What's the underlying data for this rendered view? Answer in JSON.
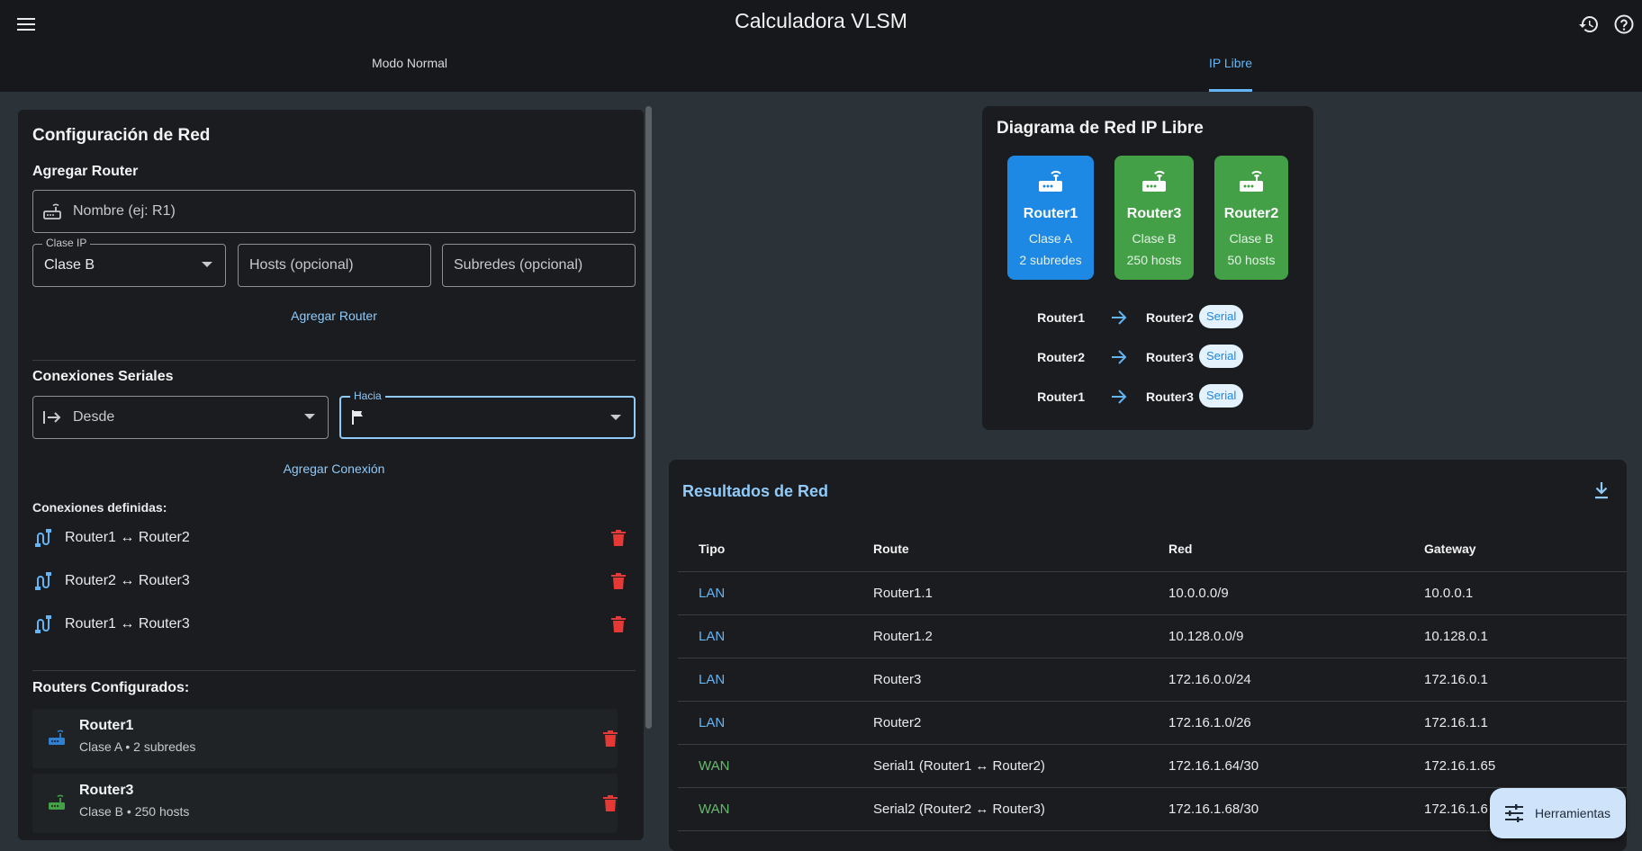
{
  "app": {
    "title": "Calculadora VLSM"
  },
  "tabs": [
    {
      "label": "Modo Normal"
    },
    {
      "label": "IP Libre"
    }
  ],
  "config": {
    "title": "Configuración de Red",
    "add_router": {
      "section_title": "Agregar Router",
      "name_placeholder": "Nombre (ej: R1)",
      "class_label": "Clase IP",
      "class_value": "Clase B",
      "hosts_placeholder": "Hosts (opcional)",
      "subnets_placeholder": "Subredes (opcional)",
      "button": "Agregar Router"
    },
    "serial": {
      "section_title": "Conexiones Seriales",
      "from_placeholder": "Desde",
      "to_label": "Hacia",
      "button": "Agregar Conexión"
    },
    "defined_title": "Conexiones definidas:",
    "connections": [
      {
        "text": "Router1 ↔ Router2"
      },
      {
        "text": "Router2 ↔ Router3"
      },
      {
        "text": "Router1 ↔ Router3"
      }
    ],
    "routers_title": "Routers Configurados:",
    "routers": [
      {
        "name": "Router1",
        "detail": "Clase A • 2 subredes",
        "color": "#2f80d0"
      },
      {
        "name": "Router3",
        "detail": "Clase B • 250 hosts",
        "color": "#43a047"
      }
    ]
  },
  "diagram": {
    "title": "Diagrama de Red IP Libre",
    "nodes": [
      {
        "name": "Router1",
        "class": "Clase A",
        "info": "2 subredes",
        "color": "#1e88e5"
      },
      {
        "name": "Router3",
        "class": "Clase B",
        "info": "250 hosts",
        "color": "#43a047"
      },
      {
        "name": "Router2",
        "class": "Clase B",
        "info": "50 hosts",
        "color": "#43a047"
      }
    ],
    "links": [
      {
        "from": "Router1",
        "to": "Router2",
        "type": "Serial"
      },
      {
        "from": "Router2",
        "to": "Router3",
        "type": "Serial"
      },
      {
        "from": "Router1",
        "to": "Router3",
        "type": "Serial"
      }
    ]
  },
  "results": {
    "title": "Resultados de Red",
    "headers": [
      "Tipo",
      "Route",
      "Red",
      "Gateway"
    ],
    "rows": [
      {
        "type": "LAN",
        "route": "Router1.1",
        "network": "10.0.0.0/9",
        "gateway": "10.0.0.1"
      },
      {
        "type": "LAN",
        "route": "Router1.2",
        "network": "10.128.0.0/9",
        "gateway": "10.128.0.1"
      },
      {
        "type": "LAN",
        "route": "Router3",
        "network": "172.16.0.0/24",
        "gateway": "172.16.0.1"
      },
      {
        "type": "LAN",
        "route": "Router2",
        "network": "172.16.1.0/26",
        "gateway": "172.16.1.1"
      },
      {
        "type": "WAN",
        "route": "Serial1 (Router1 ↔ Router2)",
        "network": "172.16.1.64/30",
        "gateway": "172.16.1.65"
      },
      {
        "type": "WAN",
        "route": "Serial2 (Router2 ↔ Router3)",
        "network": "172.16.1.68/30",
        "gateway": "172.16.1.6"
      }
    ]
  },
  "fab": {
    "label": "Herramientas"
  },
  "colors": {
    "accent": "#90caf9",
    "lan": "#64b5f6",
    "wan": "#66bb6a",
    "danger": "#e53935"
  },
  "icons": [
    "menu-icon",
    "history-icon",
    "help-icon",
    "router-icon",
    "login-icon",
    "flag-icon",
    "cable-icon",
    "delete-icon",
    "arrow-right-icon",
    "download-icon",
    "tune-icon"
  ]
}
